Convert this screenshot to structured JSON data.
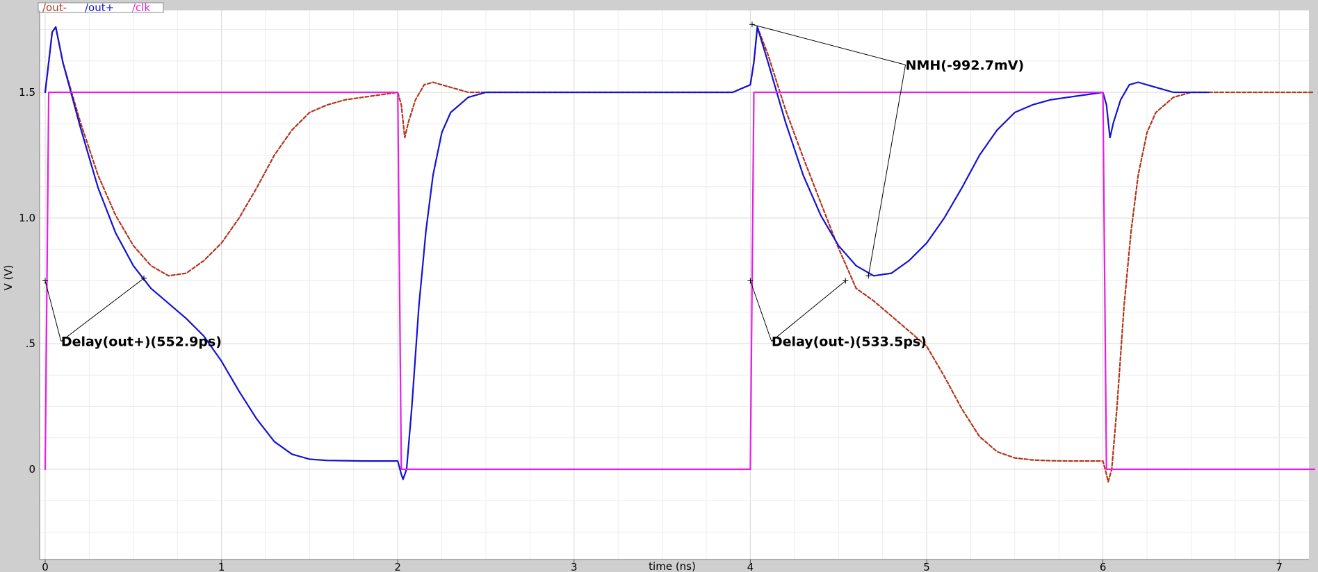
{
  "chart_data": {
    "type": "line",
    "xlabel": "time (ns)",
    "ylabel": "V (V)",
    "xlim": [
      -0.05,
      7.2
    ],
    "ylim": [
      -0.3,
      1.8
    ],
    "x_ticks": [
      "0",
      "1",
      "2",
      "3",
      "4",
      "5",
      "6",
      "7"
    ],
    "y_ticks": [
      "0",
      ".5",
      "1.0",
      "1.5"
    ],
    "grid": true,
    "legend_position": "top-left tab",
    "series": [
      {
        "name": "/out-",
        "color": "#b5351c",
        "dash": true,
        "points": [
          [
            0.0,
            1.5
          ],
          [
            0.02,
            1.62
          ],
          [
            0.04,
            1.74
          ],
          [
            0.06,
            1.76
          ],
          [
            0.1,
            1.62
          ],
          [
            0.2,
            1.38
          ],
          [
            0.3,
            1.17
          ],
          [
            0.4,
            1.01
          ],
          [
            0.5,
            0.89
          ],
          [
            0.6,
            0.81
          ],
          [
            0.7,
            0.77
          ],
          [
            0.8,
            0.78
          ],
          [
            0.9,
            0.83
          ],
          [
            1.0,
            0.9
          ],
          [
            1.1,
            1.0
          ],
          [
            1.2,
            1.12
          ],
          [
            1.3,
            1.25
          ],
          [
            1.4,
            1.35
          ],
          [
            1.5,
            1.42
          ],
          [
            1.6,
            1.45
          ],
          [
            1.7,
            1.47
          ],
          [
            1.8,
            1.48
          ],
          [
            1.9,
            1.49
          ],
          [
            2.0,
            1.5
          ],
          [
            2.02,
            1.45
          ],
          [
            2.04,
            1.32
          ],
          [
            2.06,
            1.38
          ],
          [
            2.1,
            1.47
          ],
          [
            2.15,
            1.53
          ],
          [
            2.2,
            1.54
          ],
          [
            2.3,
            1.52
          ],
          [
            2.4,
            1.5
          ],
          [
            3.9,
            1.5
          ],
          [
            4.0,
            1.53
          ],
          [
            4.02,
            1.62
          ],
          [
            4.04,
            1.76
          ],
          [
            4.1,
            1.65
          ],
          [
            4.2,
            1.43
          ],
          [
            4.3,
            1.24
          ],
          [
            4.4,
            1.06
          ],
          [
            4.5,
            0.88
          ],
          [
            4.6,
            0.72
          ],
          [
            4.7,
            0.67
          ],
          [
            4.8,
            0.61
          ],
          [
            4.9,
            0.55
          ],
          [
            5.0,
            0.49
          ],
          [
            5.1,
            0.37
          ],
          [
            5.2,
            0.24
          ],
          [
            5.3,
            0.13
          ],
          [
            5.4,
            0.07
          ],
          [
            5.5,
            0.045
          ],
          [
            5.6,
            0.037
          ],
          [
            5.7,
            0.034
          ],
          [
            5.8,
            0.033
          ],
          [
            6.0,
            0.033
          ],
          [
            6.02,
            -0.02
          ],
          [
            6.03,
            -0.05
          ],
          [
            6.05,
            0.0
          ],
          [
            6.08,
            0.25
          ],
          [
            6.12,
            0.65
          ],
          [
            6.16,
            0.95
          ],
          [
            6.2,
            1.17
          ],
          [
            6.25,
            1.34
          ],
          [
            6.3,
            1.42
          ],
          [
            6.4,
            1.48
          ],
          [
            6.5,
            1.5
          ],
          [
            7.2,
            1.5
          ]
        ]
      },
      {
        "name": "/out+",
        "color": "#1212d4",
        "dash": false,
        "points": [
          [
            0.0,
            1.5
          ],
          [
            0.02,
            1.62
          ],
          [
            0.04,
            1.74
          ],
          [
            0.06,
            1.76
          ],
          [
            0.1,
            1.62
          ],
          [
            0.2,
            1.36
          ],
          [
            0.3,
            1.12
          ],
          [
            0.4,
            0.94
          ],
          [
            0.5,
            0.81
          ],
          [
            0.6,
            0.72
          ],
          [
            0.7,
            0.66
          ],
          [
            0.8,
            0.6
          ],
          [
            0.9,
            0.53
          ],
          [
            1.0,
            0.43
          ],
          [
            1.1,
            0.31
          ],
          [
            1.2,
            0.2
          ],
          [
            1.3,
            0.11
          ],
          [
            1.4,
            0.06
          ],
          [
            1.5,
            0.04
          ],
          [
            1.6,
            0.035
          ],
          [
            1.8,
            0.033
          ],
          [
            2.0,
            0.033
          ],
          [
            2.02,
            -0.02
          ],
          [
            2.03,
            -0.04
          ],
          [
            2.05,
            0.0
          ],
          [
            2.08,
            0.25
          ],
          [
            2.12,
            0.65
          ],
          [
            2.16,
            0.95
          ],
          [
            2.2,
            1.17
          ],
          [
            2.25,
            1.34
          ],
          [
            2.3,
            1.42
          ],
          [
            2.4,
            1.48
          ],
          [
            2.5,
            1.5
          ],
          [
            3.9,
            1.5
          ],
          [
            4.0,
            1.53
          ],
          [
            4.02,
            1.62
          ],
          [
            4.04,
            1.76
          ],
          [
            4.1,
            1.62
          ],
          [
            4.2,
            1.38
          ],
          [
            4.3,
            1.17
          ],
          [
            4.4,
            1.01
          ],
          [
            4.5,
            0.89
          ],
          [
            4.6,
            0.81
          ],
          [
            4.7,
            0.77
          ],
          [
            4.8,
            0.78
          ],
          [
            4.9,
            0.83
          ],
          [
            5.0,
            0.9
          ],
          [
            5.1,
            1.0
          ],
          [
            5.2,
            1.12
          ],
          [
            5.3,
            1.25
          ],
          [
            5.4,
            1.35
          ],
          [
            5.5,
            1.42
          ],
          [
            5.6,
            1.45
          ],
          [
            5.7,
            1.47
          ],
          [
            5.8,
            1.48
          ],
          [
            5.9,
            1.49
          ],
          [
            6.0,
            1.5
          ],
          [
            6.02,
            1.45
          ],
          [
            6.04,
            1.32
          ],
          [
            6.06,
            1.38
          ],
          [
            6.1,
            1.47
          ],
          [
            6.15,
            1.53
          ],
          [
            6.2,
            1.54
          ],
          [
            6.3,
            1.52
          ],
          [
            6.4,
            1.5
          ],
          [
            6.6,
            1.5
          ]
        ]
      },
      {
        "name": "/clk",
        "color": "#e61ee6",
        "dash": false,
        "points": [
          [
            0.0,
            0.0
          ],
          [
            0.02,
            1.5
          ],
          [
            2.0,
            1.5
          ],
          [
            2.02,
            0.0
          ],
          [
            4.0,
            0.0
          ],
          [
            4.02,
            1.5
          ],
          [
            6.0,
            1.5
          ],
          [
            6.02,
            0.0
          ],
          [
            7.2,
            0.0
          ]
        ]
      }
    ],
    "annotations": [
      {
        "label": "Delay(out+)(552.9ps)",
        "marks": [
          [
            0.0,
            0.75
          ],
          [
            0.56,
            0.76
          ]
        ],
        "label_at": [
          0.09,
          0.49
        ]
      },
      {
        "label": "Delay(out-)(533.5ps)",
        "marks": [
          [
            4.0,
            0.75
          ],
          [
            4.54,
            0.75
          ]
        ],
        "label_at": [
          4.12,
          0.49
        ]
      },
      {
        "label": "NMH(-992.7mV)",
        "marks": [
          [
            4.01,
            1.77
          ],
          [
            4.67,
            0.77
          ]
        ],
        "label_at": [
          4.88,
          1.59
        ]
      }
    ]
  }
}
